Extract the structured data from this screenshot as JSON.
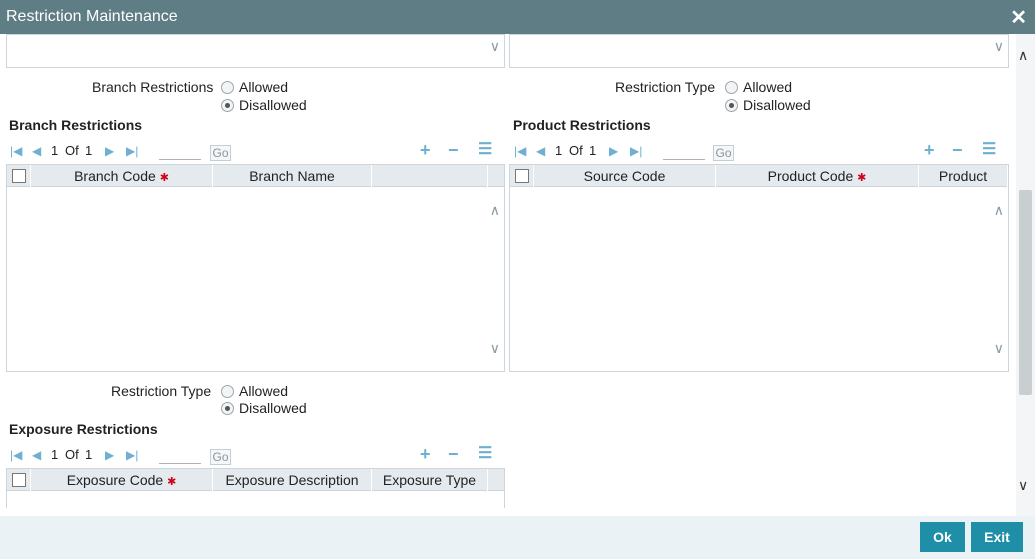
{
  "window": {
    "title": "Restriction Maintenance"
  },
  "branch_restrictions_radio": {
    "label": "Branch Restrictions",
    "options": [
      "Allowed",
      "Disallowed"
    ],
    "selected": "Disallowed"
  },
  "product_restriction_type": {
    "label": "Restriction Type",
    "options": [
      "Allowed",
      "Disallowed"
    ],
    "selected": "Disallowed"
  },
  "branch_grid": {
    "title": "Branch Restrictions",
    "page_current": "1",
    "page_of": "Of",
    "page_total": "1",
    "go_label": "Go",
    "columns": [
      "Branch Code",
      "Branch Name"
    ]
  },
  "product_grid": {
    "title": "Product Restrictions",
    "page_current": "1",
    "page_of": "Of",
    "page_total": "1",
    "go_label": "Go",
    "columns": [
      "Source Code",
      "Product Code",
      "Product"
    ]
  },
  "exposure_restriction_type": {
    "label": "Restriction Type",
    "options": [
      "Allowed",
      "Disallowed"
    ],
    "selected": "Disallowed"
  },
  "exposure_grid": {
    "title": "Exposure Restrictions",
    "page_current": "1",
    "page_of": "Of",
    "page_total": "1",
    "go_label": "Go",
    "columns": [
      "Exposure Code",
      "Exposure Description",
      "Exposure Type"
    ]
  },
  "footer": {
    "ok_label": "Ok",
    "exit_label": "Exit"
  },
  "colors": {
    "titlebar": "#5e7d85",
    "button": "#1f8fa8",
    "toolicon": "#6fb0d0",
    "required": "#d0021b"
  }
}
